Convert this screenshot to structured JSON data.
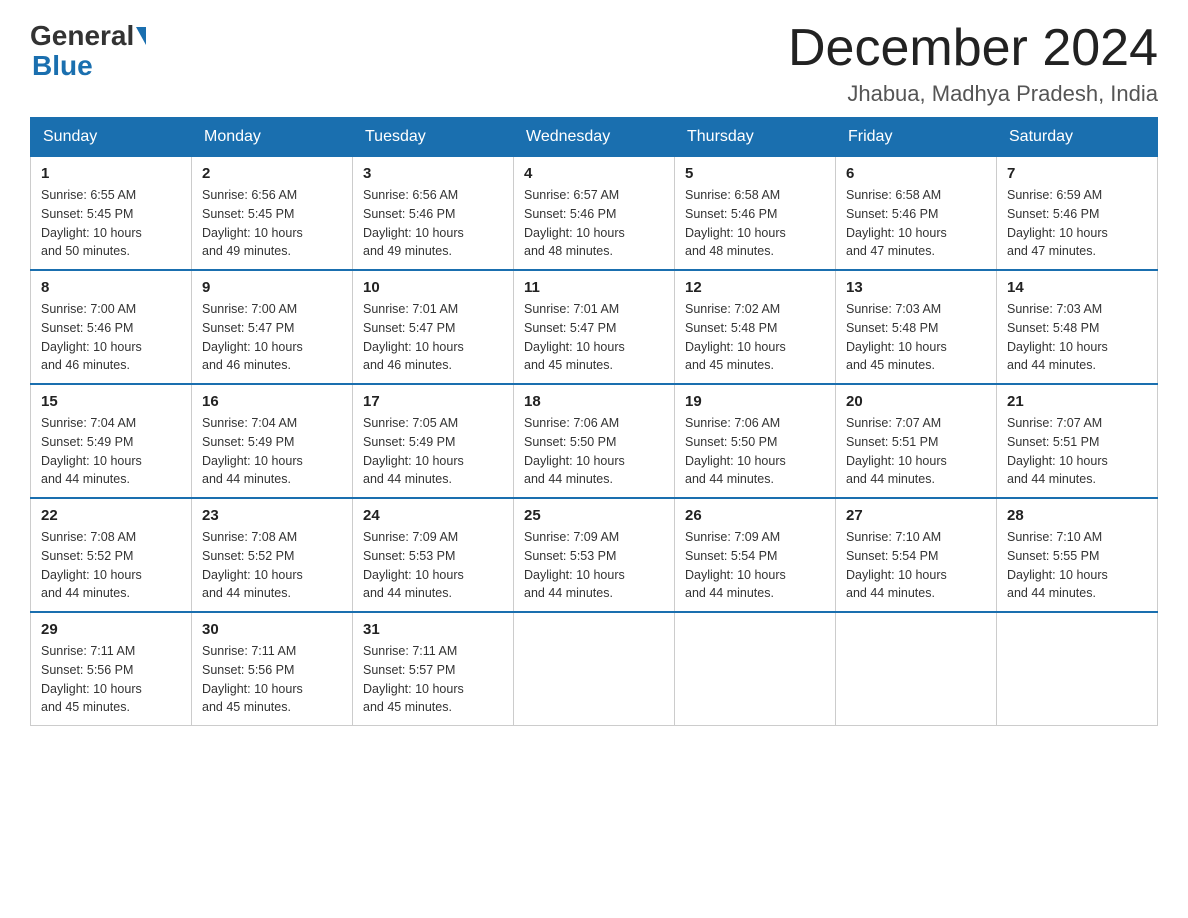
{
  "header": {
    "logo_general": "General",
    "logo_blue": "Blue",
    "title": "December 2024",
    "subtitle": "Jhabua, Madhya Pradesh, India"
  },
  "days_of_week": [
    "Sunday",
    "Monday",
    "Tuesday",
    "Wednesday",
    "Thursday",
    "Friday",
    "Saturday"
  ],
  "weeks": [
    [
      {
        "num": "1",
        "sunrise": "6:55 AM",
        "sunset": "5:45 PM",
        "daylight": "10 hours and 50 minutes."
      },
      {
        "num": "2",
        "sunrise": "6:56 AM",
        "sunset": "5:45 PM",
        "daylight": "10 hours and 49 minutes."
      },
      {
        "num": "3",
        "sunrise": "6:56 AM",
        "sunset": "5:46 PM",
        "daylight": "10 hours and 49 minutes."
      },
      {
        "num": "4",
        "sunrise": "6:57 AM",
        "sunset": "5:46 PM",
        "daylight": "10 hours and 48 minutes."
      },
      {
        "num": "5",
        "sunrise": "6:58 AM",
        "sunset": "5:46 PM",
        "daylight": "10 hours and 48 minutes."
      },
      {
        "num": "6",
        "sunrise": "6:58 AM",
        "sunset": "5:46 PM",
        "daylight": "10 hours and 47 minutes."
      },
      {
        "num": "7",
        "sunrise": "6:59 AM",
        "sunset": "5:46 PM",
        "daylight": "10 hours and 47 minutes."
      }
    ],
    [
      {
        "num": "8",
        "sunrise": "7:00 AM",
        "sunset": "5:46 PM",
        "daylight": "10 hours and 46 minutes."
      },
      {
        "num": "9",
        "sunrise": "7:00 AM",
        "sunset": "5:47 PM",
        "daylight": "10 hours and 46 minutes."
      },
      {
        "num": "10",
        "sunrise": "7:01 AM",
        "sunset": "5:47 PM",
        "daylight": "10 hours and 46 minutes."
      },
      {
        "num": "11",
        "sunrise": "7:01 AM",
        "sunset": "5:47 PM",
        "daylight": "10 hours and 45 minutes."
      },
      {
        "num": "12",
        "sunrise": "7:02 AM",
        "sunset": "5:48 PM",
        "daylight": "10 hours and 45 minutes."
      },
      {
        "num": "13",
        "sunrise": "7:03 AM",
        "sunset": "5:48 PM",
        "daylight": "10 hours and 45 minutes."
      },
      {
        "num": "14",
        "sunrise": "7:03 AM",
        "sunset": "5:48 PM",
        "daylight": "10 hours and 44 minutes."
      }
    ],
    [
      {
        "num": "15",
        "sunrise": "7:04 AM",
        "sunset": "5:49 PM",
        "daylight": "10 hours and 44 minutes."
      },
      {
        "num": "16",
        "sunrise": "7:04 AM",
        "sunset": "5:49 PM",
        "daylight": "10 hours and 44 minutes."
      },
      {
        "num": "17",
        "sunrise": "7:05 AM",
        "sunset": "5:49 PM",
        "daylight": "10 hours and 44 minutes."
      },
      {
        "num": "18",
        "sunrise": "7:06 AM",
        "sunset": "5:50 PM",
        "daylight": "10 hours and 44 minutes."
      },
      {
        "num": "19",
        "sunrise": "7:06 AM",
        "sunset": "5:50 PM",
        "daylight": "10 hours and 44 minutes."
      },
      {
        "num": "20",
        "sunrise": "7:07 AM",
        "sunset": "5:51 PM",
        "daylight": "10 hours and 44 minutes."
      },
      {
        "num": "21",
        "sunrise": "7:07 AM",
        "sunset": "5:51 PM",
        "daylight": "10 hours and 44 minutes."
      }
    ],
    [
      {
        "num": "22",
        "sunrise": "7:08 AM",
        "sunset": "5:52 PM",
        "daylight": "10 hours and 44 minutes."
      },
      {
        "num": "23",
        "sunrise": "7:08 AM",
        "sunset": "5:52 PM",
        "daylight": "10 hours and 44 minutes."
      },
      {
        "num": "24",
        "sunrise": "7:09 AM",
        "sunset": "5:53 PM",
        "daylight": "10 hours and 44 minutes."
      },
      {
        "num": "25",
        "sunrise": "7:09 AM",
        "sunset": "5:53 PM",
        "daylight": "10 hours and 44 minutes."
      },
      {
        "num": "26",
        "sunrise": "7:09 AM",
        "sunset": "5:54 PM",
        "daylight": "10 hours and 44 minutes."
      },
      {
        "num": "27",
        "sunrise": "7:10 AM",
        "sunset": "5:54 PM",
        "daylight": "10 hours and 44 minutes."
      },
      {
        "num": "28",
        "sunrise": "7:10 AM",
        "sunset": "5:55 PM",
        "daylight": "10 hours and 44 minutes."
      }
    ],
    [
      {
        "num": "29",
        "sunrise": "7:11 AM",
        "sunset": "5:56 PM",
        "daylight": "10 hours and 45 minutes."
      },
      {
        "num": "30",
        "sunrise": "7:11 AM",
        "sunset": "5:56 PM",
        "daylight": "10 hours and 45 minutes."
      },
      {
        "num": "31",
        "sunrise": "7:11 AM",
        "sunset": "5:57 PM",
        "daylight": "10 hours and 45 minutes."
      },
      null,
      null,
      null,
      null
    ]
  ],
  "labels": {
    "sunrise": "Sunrise:",
    "sunset": "Sunset:",
    "daylight": "Daylight:"
  }
}
